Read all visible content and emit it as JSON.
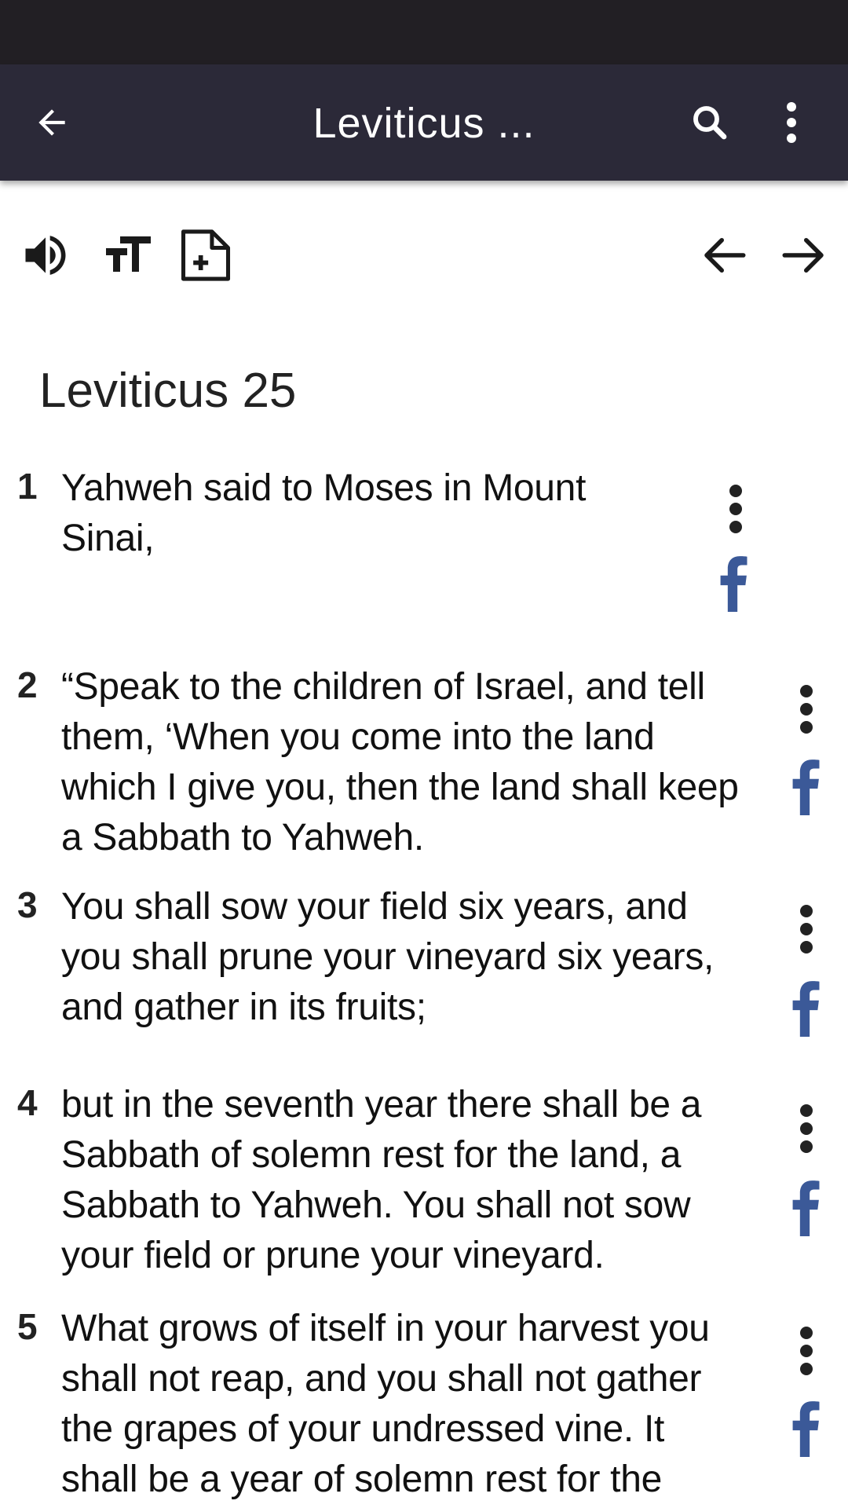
{
  "app_bar": {
    "title": "Leviticus ...",
    "back_icon": "arrow-left-icon",
    "search_icon": "search-icon",
    "more_icon": "more-vertical-icon"
  },
  "toolbar": {
    "speaker_icon": "speaker-icon",
    "text_size_icon": "text-size-icon",
    "add_note_icon": "add-note-icon",
    "prev_icon": "arrow-left-icon",
    "next_icon": "arrow-right-icon"
  },
  "chapter": {
    "title": "Leviticus 25"
  },
  "verses": [
    {
      "number": "1",
      "lines": [
        "Yahweh said to Moses in Mount",
        "Sinai,"
      ]
    },
    {
      "number": "2",
      "lines": [
        "“Speak to the children of Israel, and tell",
        "them, ‘When you come into the land",
        "which I give you, then the land shall keep",
        "a Sabbath to Yahweh."
      ]
    },
    {
      "number": "3",
      "lines": [
        "You shall sow your field six years, and",
        "you shall prune your vineyard six years,",
        "and gather in its fruits;"
      ]
    },
    {
      "number": "4",
      "lines": [
        "but in the seventh year there shall be a",
        "Sabbath of solemn rest for the land, a",
        "Sabbath to Yahweh. You shall not sow",
        "your field or prune your vineyard."
      ]
    },
    {
      "number": "5",
      "lines": [
        "What grows of itself in your harvest you",
        "shall not reap, and you shall not gather",
        "the grapes of your undressed vine. It",
        "shall be a year of solemn rest for the"
      ]
    }
  ],
  "colors": {
    "status_bar": "#221f24",
    "app_bar": "#2b2938",
    "facebook_blue": "#3b5998"
  }
}
